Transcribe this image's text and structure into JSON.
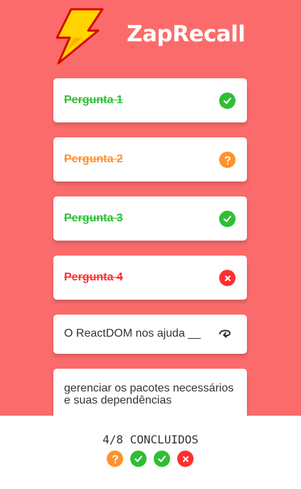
{
  "app": {
    "title": "ZapRecall"
  },
  "cards": [
    {
      "label": "Pergunta 1",
      "status": "correct",
      "icon": "check-icon",
      "color": "#2fbe34"
    },
    {
      "label": "Pergunta 2",
      "status": "almost",
      "icon": "question-icon",
      "color": "#ff922e"
    },
    {
      "label": "Pergunta 3",
      "status": "correct",
      "icon": "check-icon",
      "color": "#2fbe34"
    },
    {
      "label": "Pergunta 4",
      "status": "wrong",
      "icon": "close-icon",
      "color": "#ff3030"
    }
  ],
  "question_card": {
    "text": "O ReactDOM nos ajuda __",
    "icon": "flip-icon"
  },
  "answer_card": {
    "text": "gerenciar os pacotes necessários e suas dependências"
  },
  "footer": {
    "progress_text": "4/8 CONCLUIDOS",
    "results": [
      "question-icon",
      "check-icon",
      "check-icon",
      "close-icon"
    ]
  },
  "colors": {
    "background": "#fb6b6b",
    "correct": "#2fbe34",
    "almost": "#ff922e",
    "wrong": "#ff3030"
  }
}
